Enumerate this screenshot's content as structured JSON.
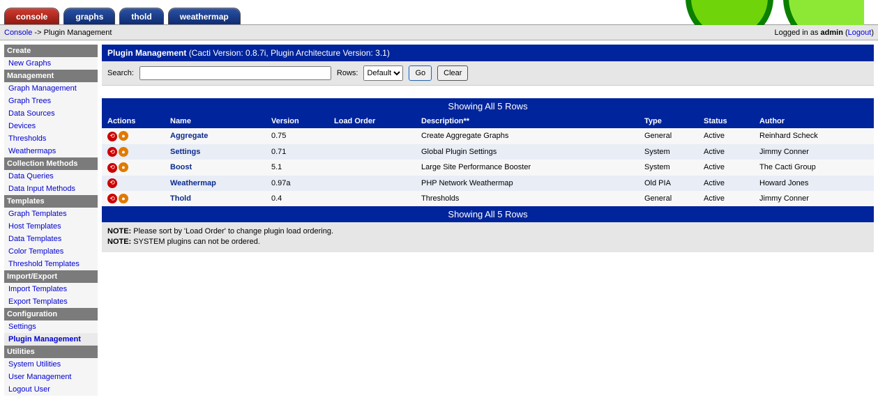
{
  "tabs": [
    "console",
    "graphs",
    "thold",
    "weathermap"
  ],
  "breadcrumb": {
    "root": "Console",
    "sep": " -> ",
    "page": "Plugin Management"
  },
  "login": {
    "text": "Logged in as ",
    "user": "admin",
    "logout": "Logout"
  },
  "sidebar": {
    "sections": [
      {
        "title": "Create",
        "items": [
          "New Graphs"
        ]
      },
      {
        "title": "Management",
        "items": [
          "Graph Management",
          "Graph Trees",
          "Data Sources",
          "Devices",
          "Thresholds",
          "Weathermaps"
        ]
      },
      {
        "title": "Collection Methods",
        "items": [
          "Data Queries",
          "Data Input Methods"
        ]
      },
      {
        "title": "Templates",
        "items": [
          "Graph Templates",
          "Host Templates",
          "Data Templates",
          "Color Templates",
          "Threshold Templates"
        ]
      },
      {
        "title": "Import/Export",
        "items": [
          "Import Templates",
          "Export Templates"
        ]
      },
      {
        "title": "Configuration",
        "items": [
          "Settings",
          "Plugin Management"
        ]
      },
      {
        "title": "Utilities",
        "items": [
          "System Utilities",
          "User Management",
          "Logout User"
        ]
      }
    ],
    "active": "Plugin Management"
  },
  "panel": {
    "title": "Plugin Management",
    "subtitle": "(Cacti Version: 0.8.7i, Plugin Architecture Version: 3.1)"
  },
  "filters": {
    "search_label": "Search:",
    "search_value": "",
    "rows_label": "Rows:",
    "rows_options": [
      "Default"
    ],
    "rows_selected": "Default",
    "go": "Go",
    "clear": "Clear"
  },
  "banner": "Showing All 5 Rows",
  "columns": [
    "Actions",
    "Name",
    "Version",
    "Load Order",
    "Description**",
    "Type",
    "Status",
    "Author"
  ],
  "plugins": [
    {
      "name": "Aggregate",
      "version": "0.75",
      "load": "",
      "desc": "Create Aggregate Graphs",
      "type": "General",
      "status": "Active",
      "author": "Reinhard Scheck",
      "acts": 2
    },
    {
      "name": "Settings",
      "version": "0.71",
      "load": "",
      "desc": "Global Plugin Settings",
      "type": "System",
      "status": "Active",
      "author": "Jimmy Conner",
      "acts": 2
    },
    {
      "name": "Boost",
      "version": "5.1",
      "load": "",
      "desc": "Large Site Performance Booster",
      "type": "System",
      "status": "Active",
      "author": "The Cacti Group",
      "acts": 2
    },
    {
      "name": "Weathermap",
      "version": "0.97a",
      "load": "",
      "desc": "PHP Network Weathermap",
      "type": "Old PIA",
      "status": "Active",
      "author": "Howard Jones",
      "acts": 1
    },
    {
      "name": "Thold",
      "version": "0.4",
      "load": "",
      "desc": "Thresholds",
      "type": "General",
      "status": "Active",
      "author": "Jimmy Conner",
      "acts": 2
    }
  ],
  "notes": {
    "label": "NOTE:",
    "lines": [
      "Please sort by 'Load Order' to change plugin load ordering.",
      "SYSTEM plugins can not be ordered."
    ]
  }
}
